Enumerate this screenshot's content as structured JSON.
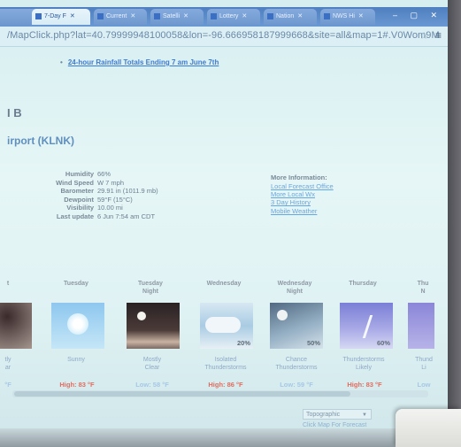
{
  "browser": {
    "tabs": [
      {
        "label": "7-Day F",
        "active": true
      },
      {
        "label": "Current",
        "active": false
      },
      {
        "label": "Satelli",
        "active": false
      },
      {
        "label": "Lottery",
        "active": false
      },
      {
        "label": "Nation",
        "active": false
      },
      {
        "label": "NWS Hi",
        "active": false
      }
    ],
    "window_controls": "–  ▢  ✕",
    "url": "/MapClick.php?lat=40.79999948100058&lon=-96.666958187999668&site=all&map=1#.V0Wom9M",
    "star_icon": "☆",
    "menu_icon": "≡"
  },
  "page": {
    "rainfall_link": "24-hour Rainfall Totals Ending 7 am June 7th",
    "marker": "I B",
    "station_title": "irport (KLNK)",
    "observations": [
      {
        "label": "Humidity",
        "value": "66%"
      },
      {
        "label": "Wind Speed",
        "value": "W 7 mph"
      },
      {
        "label": "Barometer",
        "value": "29.91 in (1011.9 mb)"
      },
      {
        "label": "Dewpoint",
        "value": "59°F (15°C)"
      },
      {
        "label": "Visibility",
        "value": "10.00 mi"
      },
      {
        "label": "Last update",
        "value": "6 Jun 7:54 am CDT"
      }
    ],
    "more_info": {
      "heading": "More Information:",
      "links": [
        "Local Forecast Office",
        "More Local Wx",
        "3 Day History",
        "Mobile Weather"
      ]
    }
  },
  "forecast": [
    {
      "period": "t",
      "period2": "",
      "icon": "night",
      "pop": "",
      "desc1": "tly",
      "desc2": "ar",
      "temp": "°F",
      "kind": "low"
    },
    {
      "period": "Tuesday",
      "period2": "",
      "icon": "sunny",
      "pop": "",
      "desc1": "Sunny",
      "desc2": "",
      "temp": "High: 83 °F",
      "kind": "high"
    },
    {
      "period": "Tuesday",
      "period2": "Night",
      "icon": "night",
      "pop": "",
      "desc1": "Mostly",
      "desc2": "Clear",
      "temp": "Low: 58 °F",
      "kind": "low"
    },
    {
      "period": "Wednesday",
      "period2": "",
      "icon": "tstorm-day",
      "pop": "20%",
      "desc1": "Isolated",
      "desc2": "Thunderstorms",
      "temp": "High: 86 °F",
      "kind": "high"
    },
    {
      "period": "Wednesday",
      "period2": "Night",
      "icon": "tstorm-night",
      "pop": "50%",
      "desc1": "Chance",
      "desc2": "Thunderstorms",
      "temp": "Low: 59 °F",
      "kind": "low"
    },
    {
      "period": "Thursday",
      "period2": "",
      "icon": "lightning",
      "pop": "60%",
      "desc1": "Thunderstorms",
      "desc2": "Likely",
      "temp": "High: 83 °F",
      "kind": "high"
    },
    {
      "period": "Thu",
      "period2": "N",
      "icon": "lightning",
      "pop": "",
      "desc1": "Thund",
      "desc2": "Li",
      "temp": "Low",
      "kind": "low"
    }
  ],
  "footer": {
    "select_value": "Topographic",
    "map_link": "Click Map For Forecast"
  },
  "colors": {
    "high_temp": "#e46b5e",
    "low_temp": "#a6c7e6",
    "link": "#3e7bd4"
  }
}
